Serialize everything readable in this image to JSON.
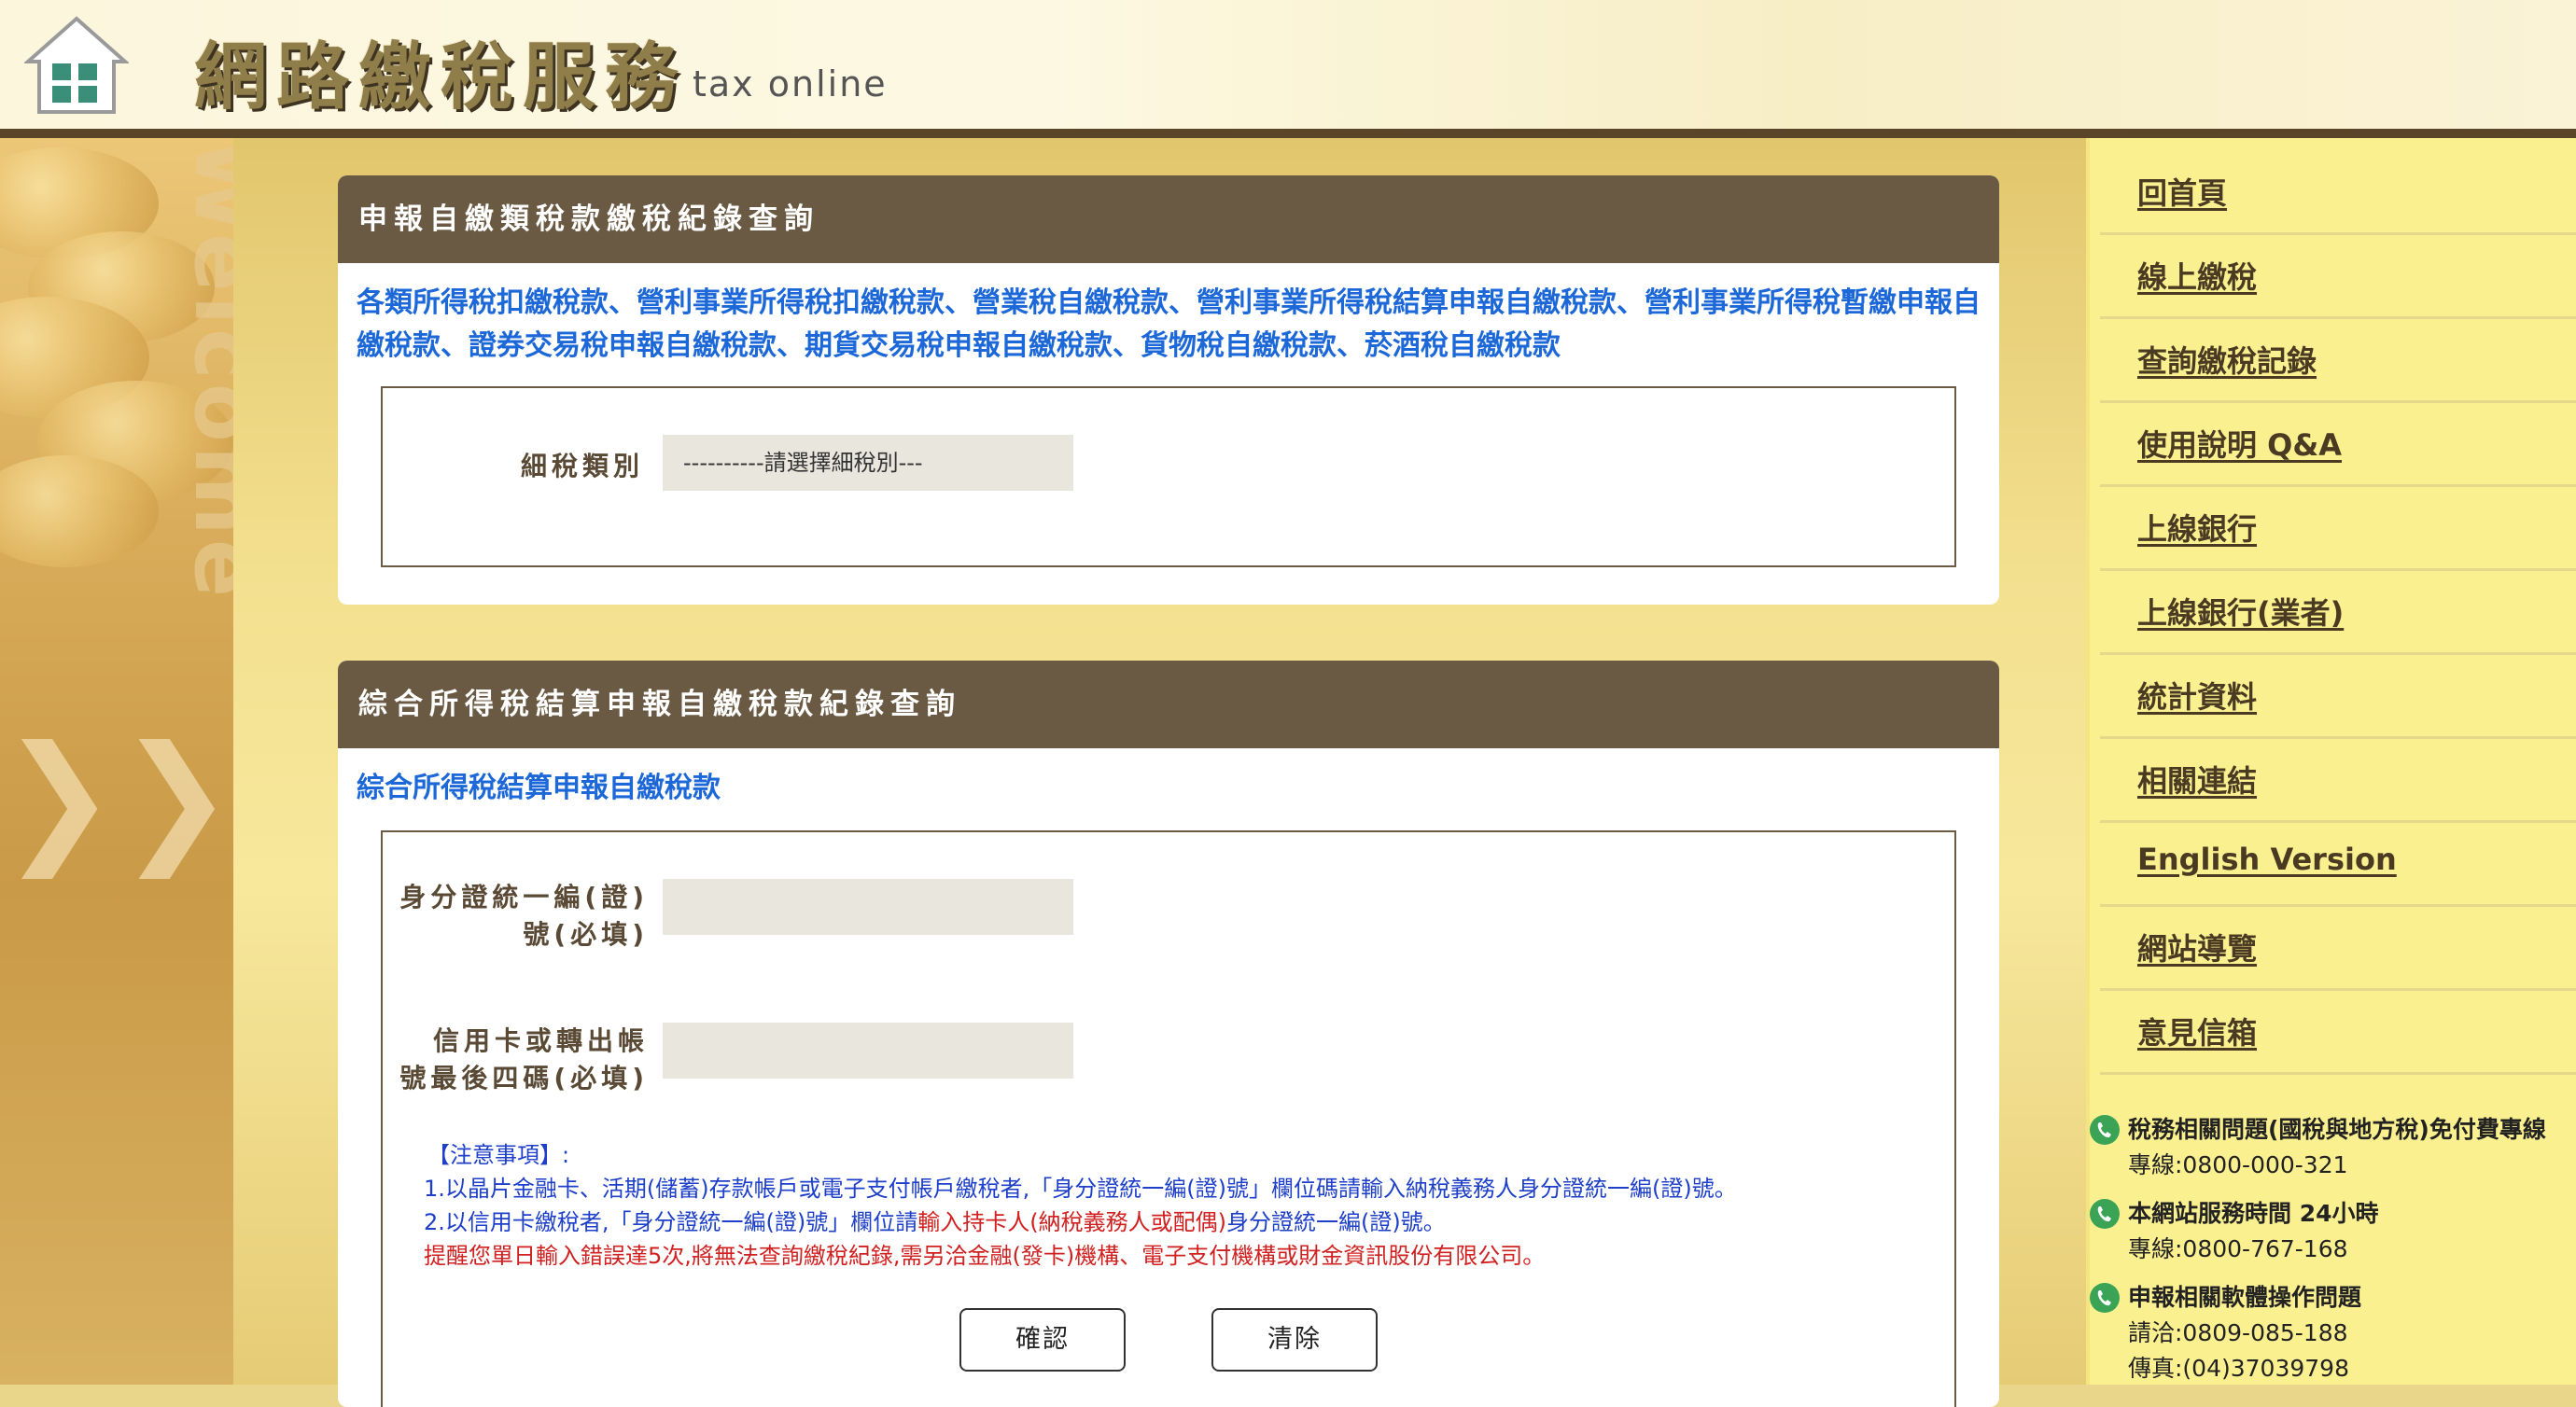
{
  "header": {
    "title": "網路繳稅服務",
    "subtitle": "tax online"
  },
  "decor": {
    "welcome": "Welcome",
    "chevrons": "❯❯"
  },
  "panel1": {
    "heading": "申報自繳類稅款繳稅紀錄查詢",
    "description": "各類所得稅扣繳稅款、營利事業所得稅扣繳稅款、營業稅自繳稅款、營利事業所得稅結算申報自繳稅款、營利事業所得稅暫繳申報自繳稅款、證券交易稅申報自繳稅款、期貨交易稅申報自繳稅款、貨物稅自繳稅款、菸酒稅自繳稅款",
    "field_label": "細稅類別",
    "select_value": "----------請選擇細稅別---"
  },
  "panel2": {
    "heading": "綜合所得稅結算申報自繳稅款紀錄查詢",
    "description": "綜合所得稅結算申報自繳稅款",
    "id_label_1": "身分證統一編(證)",
    "id_label_2": "號(必填)",
    "card_label_1": "信用卡或轉出帳",
    "card_label_2": "號最後四碼(必填)",
    "notes": {
      "title": "【注意事項】:",
      "line1": "1.以晶片金融卡、活期(儲蓄)存款帳戶或電子支付帳戶繳稅者,「身分證統一編(證)號」欄位碼請輸入納稅義務人身分證統一編(證)號。",
      "line2_blue": "2.以信用卡繳稅者,「身分證統一編(證)號」欄位請",
      "line2_red": "輸入持卡人(納稅義務人或配偶)",
      "line2_blue_end": "身分證統一編(證)號。",
      "line3": "提醒您單日輸入錯誤達5次,將無法查詢繳稅紀錄,需另洽金融(發卡)機構、電子支付機構或財金資訊股份有限公司。"
    },
    "confirm_label": "確認",
    "clear_label": "清除"
  },
  "sidebar": {
    "items": [
      {
        "label": "回首頁"
      },
      {
        "label": "線上繳稅"
      },
      {
        "label": "查詢繳稅記錄"
      },
      {
        "label": "使用說明 Q&A"
      },
      {
        "label": "上線銀行"
      },
      {
        "label": "上線銀行(業者)"
      },
      {
        "label": "統計資料"
      },
      {
        "label": "相關連結"
      },
      {
        "label": "English Version"
      },
      {
        "label": "網站導覽"
      },
      {
        "label": "意見信箱"
      }
    ],
    "contacts": [
      {
        "title": "稅務相關問題(國稅與地方稅)免付費專線",
        "line1": "專線:0800-000-321"
      },
      {
        "title": "本網站服務時間 24小時",
        "line1": "專線:0800-767-168"
      },
      {
        "title": "申報相關軟體操作問題",
        "line1": "請洽:0809-085-188",
        "line2": "傳真:(04)37039798"
      }
    ]
  },
  "colors": {
    "panel_header": "#6a5a43",
    "link_blue": "#1d68d8",
    "sidebar_bg": "#fbf08f",
    "note_red": "#d02020"
  }
}
